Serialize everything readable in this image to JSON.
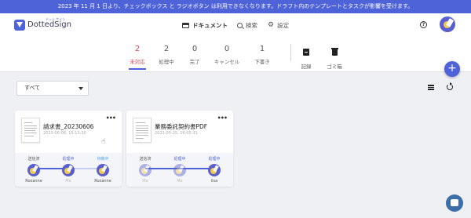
{
  "banner": {
    "text": "2023 年 11 月 1 日より、チェックボックス と ラジオボタン は利用できなくなります。ドラフト内のテンプレートとタスクが影響を受けます。"
  },
  "header": {
    "logo_ruby": "ドット サイン",
    "logo_text": "DottedSign",
    "nav_documents": "ドキュメント",
    "nav_search": "検索",
    "nav_settings": "設定",
    "help": "?"
  },
  "statuses": [
    {
      "count": "2",
      "label": "未対応"
    },
    {
      "count": "2",
      "label": "処理中"
    },
    {
      "count": "0",
      "label": "完了"
    },
    {
      "count": "0",
      "label": "キャンセル"
    },
    {
      "count": "1",
      "label": "下書き"
    }
  ],
  "tools": {
    "records": "記録",
    "trash": "ゴミ箱"
  },
  "fab": "+",
  "filter": {
    "selected": "すべて"
  },
  "cards": [
    {
      "title": "請求書_20230606",
      "date": "2023-06-06, 15:13:30",
      "menu": "•••",
      "steps": [
        {
          "status": "送信済",
          "name": "Roxanne"
        },
        {
          "status": "処理中",
          "name": "Me"
        },
        {
          "status": "待機中",
          "name": "Roxanne"
        }
      ]
    },
    {
      "title": "業務委託契約書PDF",
      "date": "2023-05-25, 16:05:31",
      "menu": "•••",
      "steps": [
        {
          "status": "送信済",
          "name": "Me"
        },
        {
          "status": "処理中",
          "name": "Me"
        },
        {
          "status": "処理中",
          "name": "lisa"
        }
      ]
    }
  ]
}
